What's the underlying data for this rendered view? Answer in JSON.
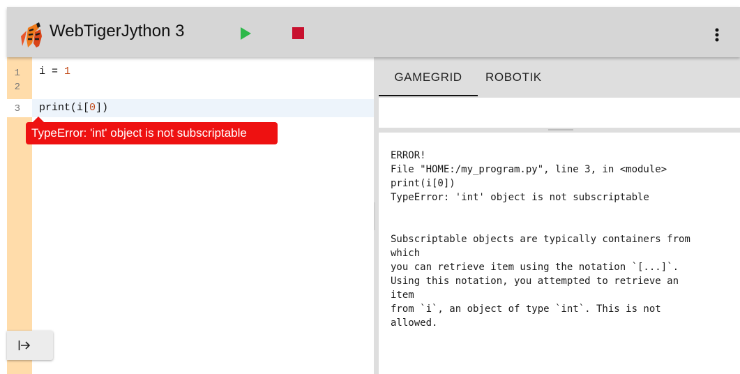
{
  "header": {
    "title": "WebTigerJython 3",
    "run_icon": "play-icon",
    "stop_icon": "stop-icon",
    "menu_icon": "more-vertical-icon",
    "colors": {
      "background": "#d6d6d6",
      "run": "#2db84a",
      "stop": "#c8102e"
    }
  },
  "editor": {
    "lines": [
      {
        "num": "1",
        "parts": [
          "i = ",
          "1"
        ]
      },
      {
        "num": "2",
        "parts": []
      },
      {
        "num": "3",
        "parts": [
          "print(i[",
          "0",
          "])"
        ]
      }
    ],
    "error_message": "TypeError: 'int' object is not subscriptable",
    "collapse_icon": "arrow-right-to-bar-icon"
  },
  "panel": {
    "tabs": [
      {
        "label": "GAMEGRID",
        "active": true
      },
      {
        "label": "ROBOTIK",
        "active": false
      }
    ],
    "console": {
      "block1": [
        "ERROR!",
        "File \"HOME:/my_program.py\", line 3, in <module>",
        "print(i[0])",
        "TypeError: 'int' object is not subscriptable"
      ],
      "block2": [
        "Subscriptable objects are typically containers from",
        "which",
        "you can retrieve item using the notation `[...]`.",
        "Using this notation, you attempted to retrieve an",
        "item",
        "from `i`, an object of type `int`. This is not",
        "allowed."
      ]
    }
  }
}
